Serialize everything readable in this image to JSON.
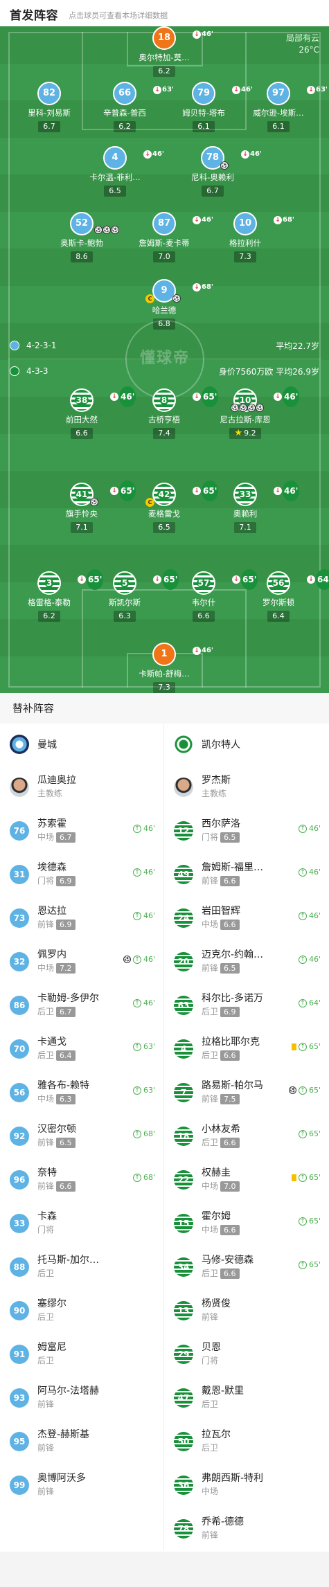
{
  "header": {
    "title": "首发阵容",
    "subtitle": "点击球员可查看本场详细数据"
  },
  "weather": {
    "line1": "局部有云",
    "line2": "26°C"
  },
  "watermark": "懂球帝",
  "teams": {
    "mancity": {
      "formation": "4-2-3-1",
      "avg_age": "平均22.7岁",
      "color": "#5eb3e4"
    },
    "celtic": {
      "formation": "4-3-3",
      "value": "身价7560万欧",
      "avg_age": "平均26.9岁",
      "color": "#19913a"
    }
  },
  "pitch_players": [
    {
      "num": "18",
      "name": "奥尔特加-莫…",
      "rating": "6.2",
      "sub": "46'"
    },
    {
      "num": "82",
      "name": "里科-刘易斯",
      "rating": "6.7",
      "sub": ""
    },
    {
      "num": "66",
      "name": "辛普森-普西",
      "rating": "6.2",
      "sub": "63'"
    },
    {
      "num": "79",
      "name": "姆贝特-塔布",
      "rating": "6.1",
      "sub": "46'"
    },
    {
      "num": "97",
      "name": "威尔逊-埃斯…",
      "rating": "6.1",
      "sub": "63'"
    },
    {
      "num": "4",
      "name": "卡尔温-菲利…",
      "rating": "6.5",
      "sub": "46'"
    },
    {
      "num": "78",
      "name": "尼科-奥赖利",
      "rating": "6.7",
      "sub": "46'"
    },
    {
      "num": "52",
      "name": "奥斯卡-鲍勃",
      "rating": "8.6",
      "sub": ""
    },
    {
      "num": "87",
      "name": "詹姆斯-麦卡蒂",
      "rating": "7.0",
      "sub": "46'"
    },
    {
      "num": "10",
      "name": "格拉利什",
      "rating": "7.3",
      "sub": "68'"
    },
    {
      "num": "9",
      "name": "哈兰德",
      "rating": "6.8",
      "sub": "68'"
    },
    {
      "num": "38",
      "name": "前田大然",
      "rating": "6.6",
      "sub": "46'"
    },
    {
      "num": "8",
      "name": "古桥亨梧",
      "rating": "7.4",
      "sub": "65'"
    },
    {
      "num": "10",
      "name": "尼古拉斯-库恩",
      "rating": "9.2",
      "sub": "46'"
    },
    {
      "num": "41",
      "name": "旗手怜央",
      "rating": "7.1",
      "sub": "65'"
    },
    {
      "num": "42",
      "name": "麦格雷戈",
      "rating": "6.5",
      "sub": "65'"
    },
    {
      "num": "33",
      "name": "奥赖利",
      "rating": "7.1",
      "sub": "46'"
    },
    {
      "num": "3",
      "name": "格雷格-泰勒",
      "rating": "6.2",
      "sub": "65'"
    },
    {
      "num": "5",
      "name": "斯凯尔斯",
      "rating": "6.3",
      "sub": "65'"
    },
    {
      "num": "57",
      "name": "韦尔什",
      "rating": "6.6",
      "sub": "65'"
    },
    {
      "num": "56",
      "name": "罗尔斯顿",
      "rating": "6.4",
      "sub": "64'"
    },
    {
      "num": "1",
      "name": "卡斯帕-舒梅…",
      "rating": "7.3",
      "sub": "46'"
    }
  ],
  "subs": {
    "title": "替补阵容",
    "home": {
      "team": "曼城",
      "coach": {
        "name": "瓜迪奥拉",
        "role": "主教练"
      },
      "players": [
        {
          "num": "76",
          "name": "苏索霍",
          "pos": "中场",
          "rating": "6.7",
          "in": "46'"
        },
        {
          "num": "31",
          "name": "埃德森",
          "pos": "门将",
          "rating": "6.9",
          "in": "46'"
        },
        {
          "num": "73",
          "name": "恩达拉",
          "pos": "前锋",
          "rating": "6.9",
          "in": "46'"
        },
        {
          "num": "32",
          "name": "佩罗内",
          "pos": "中场",
          "rating": "7.2",
          "in": "46'"
        },
        {
          "num": "86",
          "name": "卡勒姆-多伊尔",
          "pos": "后卫",
          "rating": "6.7",
          "in": "46'"
        },
        {
          "num": "70",
          "name": "卡通戈",
          "pos": "后卫",
          "rating": "6.4",
          "in": "63'"
        },
        {
          "num": "56",
          "name": "雅各布-赖特",
          "pos": "中场",
          "rating": "6.3",
          "in": "63'"
        },
        {
          "num": "92",
          "name": "汉密尔顿",
          "pos": "前锋",
          "rating": "6.5",
          "in": "68'"
        },
        {
          "num": "96",
          "name": "奈特",
          "pos": "前锋",
          "rating": "6.6",
          "in": "68'"
        },
        {
          "num": "33",
          "name": "卡森",
          "pos": "门将",
          "rating": "",
          "in": ""
        },
        {
          "num": "88",
          "name": "托马斯-加尔…",
          "pos": "后卫",
          "rating": "",
          "in": ""
        },
        {
          "num": "90",
          "name": "塞缪尔",
          "pos": "后卫",
          "rating": "",
          "in": ""
        },
        {
          "num": "91",
          "name": "姆富尼",
          "pos": "后卫",
          "rating": "",
          "in": ""
        },
        {
          "num": "93",
          "name": "阿马尔-法塔赫",
          "pos": "前锋",
          "rating": "",
          "in": ""
        },
        {
          "num": "95",
          "name": "杰登-赫斯基",
          "pos": "前锋",
          "rating": "",
          "in": ""
        },
        {
          "num": "99",
          "name": "奥博阿沃多",
          "pos": "前锋",
          "rating": "",
          "in": ""
        }
      ]
    },
    "away": {
      "team": "凯尔特人",
      "coach": {
        "name": "罗杰斯",
        "role": "主教练"
      },
      "players": [
        {
          "num": "12",
          "name": "西尔萨洛",
          "pos": "门将",
          "rating": "6.5",
          "in": "46'"
        },
        {
          "num": "49",
          "name": "詹姆斯-福里…",
          "pos": "前锋",
          "rating": "6.6",
          "in": "46'"
        },
        {
          "num": "24",
          "name": "岩田智辉",
          "pos": "中场",
          "rating": "6.6",
          "in": "46'"
        },
        {
          "num": "20",
          "name": "迈克尔-约翰…",
          "pos": "前锋",
          "rating": "6.5",
          "in": "46'"
        },
        {
          "num": "63",
          "name": "科尔比-多诺万",
          "pos": "后卫",
          "rating": "6.9",
          "in": "64'"
        },
        {
          "num": "4",
          "name": "拉格比耶尔克",
          "pos": "后卫",
          "rating": "6.6",
          "in": "65'"
        },
        {
          "num": "7",
          "name": "路易斯-帕尔马",
          "pos": "前锋",
          "rating": "7.5",
          "in": "65'"
        },
        {
          "num": "18",
          "name": "小林友希",
          "pos": "后卫",
          "rating": "6.6",
          "in": "65'"
        },
        {
          "num": "22",
          "name": "权赫圭",
          "pos": "中场",
          "rating": "7.0",
          "in": "65'"
        },
        {
          "num": "15",
          "name": "霍尔姆",
          "pos": "中场",
          "rating": "6.6",
          "in": "65'"
        },
        {
          "num": "34",
          "name": "马修-安德森",
          "pos": "后卫",
          "rating": "6.6",
          "in": "65'"
        },
        {
          "num": "13",
          "name": "杨贤俊",
          "pos": "前锋",
          "rating": "",
          "in": ""
        },
        {
          "num": "29",
          "name": "贝恩",
          "pos": "门将",
          "rating": "",
          "in": ""
        },
        {
          "num": "47",
          "name": "戴恩-默里",
          "pos": "后卫",
          "rating": "",
          "in": ""
        },
        {
          "num": "50",
          "name": "拉瓦尔",
          "pos": "后卫",
          "rating": "",
          "in": ""
        },
        {
          "num": "36",
          "name": "弗朗西斯-特利",
          "pos": "中场",
          "rating": "",
          "in": ""
        },
        {
          "num": "78",
          "name": "乔希-德德",
          "pos": "前锋",
          "rating": "",
          "in": ""
        }
      ]
    }
  }
}
